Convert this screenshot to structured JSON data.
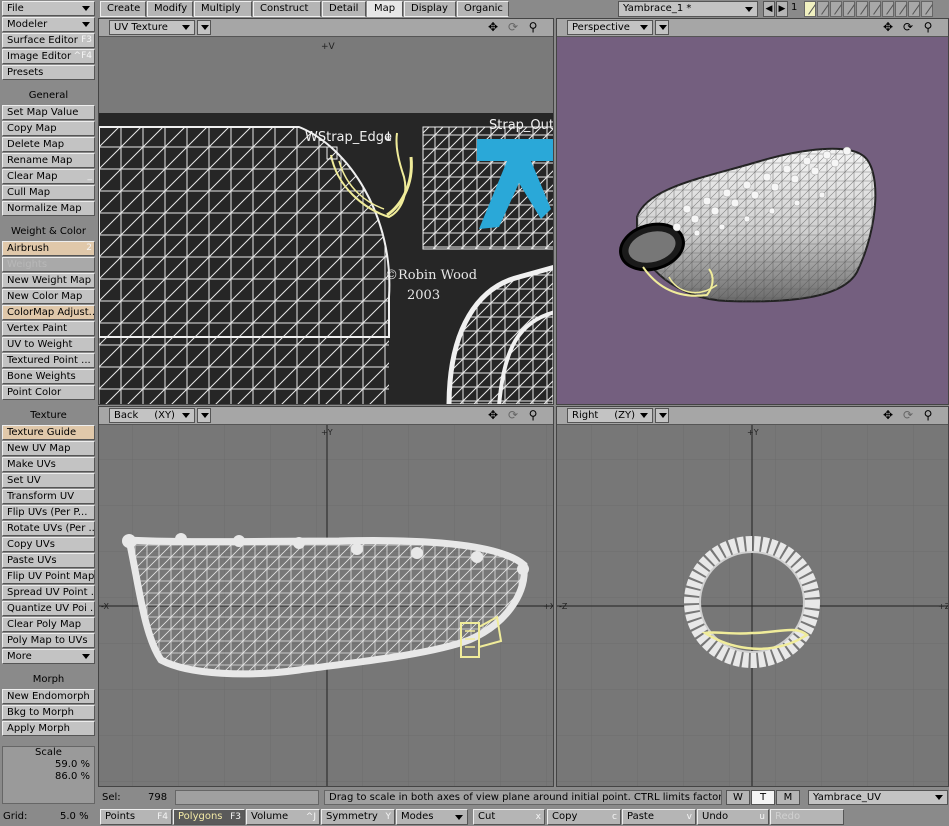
{
  "sidebar": {
    "file": "File",
    "modeler": "Modeler",
    "surface_editor": {
      "label": "Surface Editor",
      "key": "F3"
    },
    "image_editor": {
      "label": "Image Editor",
      "key": "^F4"
    },
    "presets": "Presets",
    "general_header": "General",
    "general": [
      "Set Map Value",
      "Copy Map",
      "Delete Map",
      "Rename Map",
      "Clear Map",
      "Cull Map",
      "Normalize Map"
    ],
    "clear_map_key": "_",
    "weight_header": "Weight & Color",
    "airbrush": {
      "label": "Airbrush",
      "key": "2"
    },
    "weights": "Weights",
    "weight_items": [
      "New Weight Map",
      "New Color Map",
      "ColorMap Adjust...",
      "Vertex Paint",
      "UV to Weight",
      "Textured Point ...",
      "Bone Weights",
      "Point Color"
    ],
    "texture_header": "Texture",
    "texture_items": [
      "Texture Guide",
      "New UV Map",
      "Make UVs",
      "Set UV",
      "Transform UV",
      "Flip UVs (Per P...",
      "Rotate UVs (Per ...",
      "Copy UVs",
      "Paste UVs",
      "Flip UV Point Map",
      "Spread UV Point ...",
      "Quantize UV Poi ...",
      "Clear Poly Map",
      "Poly Map to UVs"
    ],
    "more": "More",
    "morph_header": "Morph",
    "morph_items": [
      "New Endomorph",
      "Bkg to Morph",
      "Apply Morph"
    ],
    "scale_label": "Scale",
    "scale_x": "59.0 %",
    "scale_y": "86.0 %"
  },
  "tabs": [
    "Create",
    "Modify",
    "Multiply",
    "Construct",
    "Detail",
    "Map",
    "Display",
    "Organic"
  ],
  "active_tab": "Map",
  "scene_name": "Yambrace_1 *",
  "layer_number": "1",
  "viewports": {
    "uv": {
      "mode": "UV Texture",
      "axis": "+V",
      "labels": {
        "wstrap": "WStrap_Edge",
        "strap": "Strap_Outer",
        "credit": "©Robin Wood",
        "year": "2003"
      }
    },
    "persp": {
      "mode": "Perspective"
    },
    "back": {
      "mode": "Back",
      "plane": "(XY)",
      "axis_top": "+Y",
      "axis_left": "-X",
      "axis_right": "+X"
    },
    "right": {
      "mode": "Right",
      "plane": "(ZY)",
      "axis_top": "+Y",
      "axis_left": "-Z",
      "axis_right": "+Z"
    }
  },
  "status": {
    "sel_label": "Sel:",
    "sel_value": "798",
    "hint": "Drag to scale in both axes of view plane around initial point. CTRL limits factors.",
    "wtm": [
      "W",
      "T",
      "M"
    ],
    "vmap": "Yambrace_UV"
  },
  "bottom": {
    "grid_label": "Grid:",
    "grid_value": "5.0 %",
    "points": {
      "label": "Points",
      "key": "F4"
    },
    "polygons": {
      "label": "Polygons",
      "key": "F3"
    },
    "volume": {
      "label": "Volume",
      "key": "^J"
    },
    "symmetry": {
      "label": "Symmetry",
      "key": "Y"
    },
    "modes": "Modes",
    "cut": {
      "label": "Cut",
      "key": "x"
    },
    "copy": {
      "label": "Copy",
      "key": "c"
    },
    "paste": {
      "label": "Paste",
      "key": "v"
    },
    "undo": {
      "label": "Undo",
      "key": "u"
    },
    "redo": "Redo"
  },
  "colors": {
    "ui_gray": "#8a8a8a",
    "button": "#c3c3c3",
    "persp_bg": "#745f7f",
    "uv_bg": "#262626",
    "highlight": "#f0ec9a",
    "strap_blue": "#2aa8d8"
  }
}
